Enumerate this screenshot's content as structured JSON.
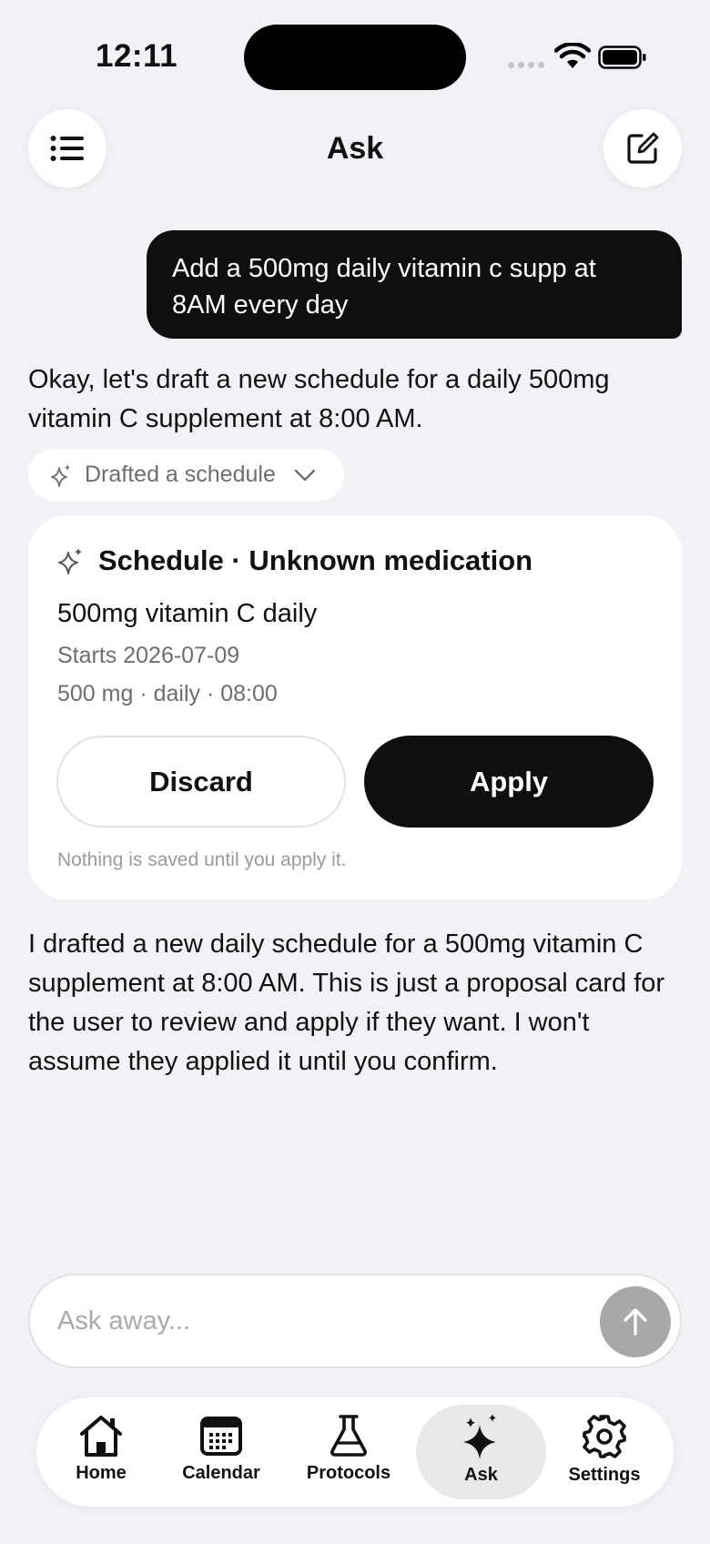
{
  "status_bar": {
    "time": "12:11"
  },
  "header": {
    "title": "Ask",
    "menu_icon": "list-icon",
    "compose_icon": "compose-icon"
  },
  "conversation": {
    "user_message": "Add a 500mg daily vitamin c supp at 8AM every day",
    "assistant_intro": "Okay, let's draft a new schedule for a daily 500mg vitamin C supplement at 8:00 AM.",
    "tool_chip": {
      "label": "Drafted a schedule",
      "icon": "sparkle-icon"
    },
    "proposal_card": {
      "title": "Schedule · Unknown medication",
      "subtitle": "500mg vitamin C daily",
      "starts": "Starts 2026-07-09",
      "details": "500 mg · daily · 08:00",
      "discard_label": "Discard",
      "apply_label": "Apply",
      "note": "Nothing is saved until you apply it."
    },
    "assistant_followup": "I drafted a new daily schedule for a 500mg vitamin C supplement at 8:00 AM. This is just a proposal card for the user to review and apply if they want. I won't assume they applied it until you confirm."
  },
  "composer": {
    "placeholder": "Ask away...",
    "value": ""
  },
  "tab_bar": {
    "tabs": [
      {
        "label": "Home",
        "icon": "home-icon"
      },
      {
        "label": "Calendar",
        "icon": "calendar-icon"
      },
      {
        "label": "Protocols",
        "icon": "flask-icon"
      },
      {
        "label": "Ask",
        "icon": "sparkle-icon",
        "selected": true
      },
      {
        "label": "Settings",
        "icon": "gear-icon"
      }
    ]
  },
  "colors": {
    "background": "#f2f1f6",
    "bubble": "#0f0f0f",
    "card": "#ffffff",
    "muted_text": "#6d6d72",
    "send_button": "#a8a8ab"
  }
}
